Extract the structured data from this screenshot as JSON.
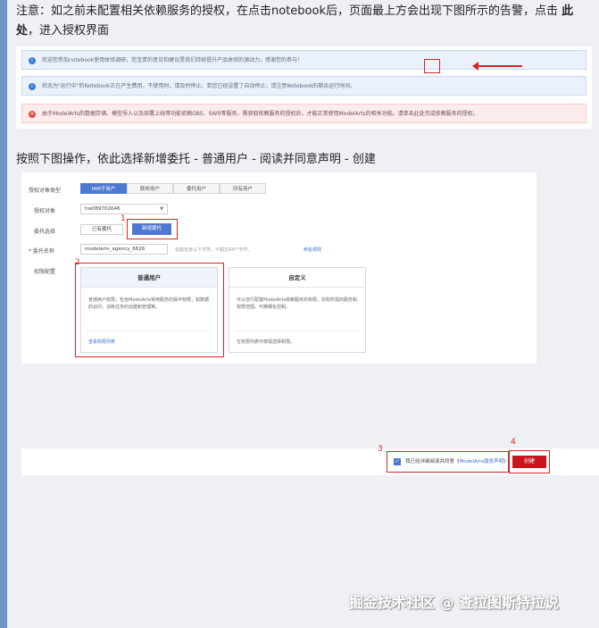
{
  "note": {
    "part1": "注意：如之前未配置相关依赖服务的授权，在点击notebook后，页面最上方会出现下图所示的告警，点击 ",
    "bold": "此处",
    "part2": "，进入授权界面"
  },
  "alerts": [
    {
      "type": "info",
      "text": "欢迎您参加notebook使用体验调研，您宝贵的意见和建议是我们持续提升产品体验的源动力，感谢您的参与！"
    },
    {
      "type": "info",
      "text": "状态为\"运行中\"的Notebook正在产生费用，不使用时，请及时停止。若您已经设置了自动停止，请注意Notebook的剩余运行时间。"
    },
    {
      "type": "error",
      "text": "由于ModelArts的数据存储、模型导入以及部署上线等功能依赖OBS、SWR等服务，需获取依赖服务的授权后，才能正常使用ModelArts的相关功能。请单击此处完成依赖服务的授权。"
    }
  ],
  "instruction": "按照下图操作，依此选择新增委托 - 普通用户 - 阅读并同意声明 - 创建",
  "form": {
    "target_type_label": "授权对象类型",
    "target_types": [
      "IAM子用户",
      "联邦用户",
      "委托用户",
      "所有用户"
    ],
    "target_label": "授权对象",
    "target_value": "hw089702646",
    "agency_select_label": "委托选择",
    "existing_agency": "已有委托",
    "new_agency": "新增委托",
    "agency_name_label": "* 委托名称",
    "agency_name_value": "modelarts_agency_6626",
    "agency_name_hint": "仅能包含以下字符，不超过64个字符。",
    "agency_name_link": "命名规则",
    "permission_label": "权限配置",
    "cards": [
      {
        "title": "普通用户",
        "desc": "普通用户权限，包含ModelArts常用服务的操作权限，如数据的访问、训练任务的创建和管理等。",
        "footer": "查看权限列表"
      },
      {
        "title": "自定义",
        "desc": "可以自行配置ModelArts依赖服务的权限，授权所需的服务和权限范围，可精细化控制。",
        "footer": "在权限列表中按需选择权限。"
      }
    ]
  },
  "markers": [
    "1",
    "2",
    "3",
    "4"
  ],
  "footer": {
    "agree_prefix": "我已经详细阅读并同意《",
    "agree_link": "ModelArts服务声明",
    "agree_suffix": "》",
    "create_button": "创建"
  },
  "watermark": "掘金技术社区 @ 查拉图斯特拉说",
  "colors": {
    "accent": "#4f78d1",
    "highlight": "#d9242a",
    "create": "#c8161d"
  }
}
